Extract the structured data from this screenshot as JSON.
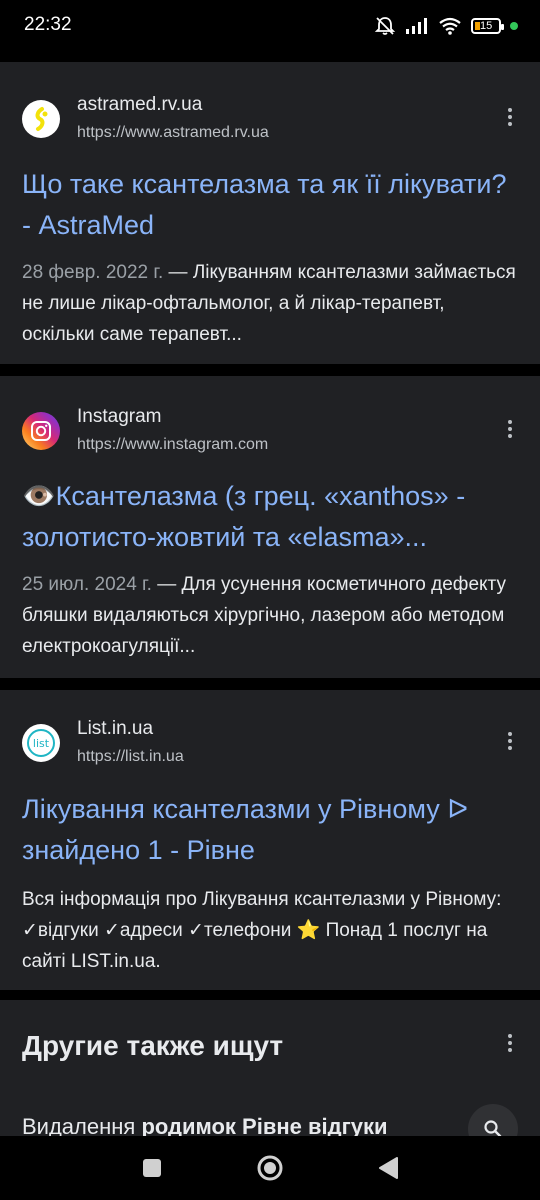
{
  "status_bar": {
    "time": "22:32",
    "battery": "15",
    "icons": [
      "mute-icon",
      "signal-icon",
      "wifi-icon",
      "battery-icon",
      "dot-icon"
    ]
  },
  "results": [
    {
      "site_name": "astramed.rv.ua",
      "url": "https://www.astramed.rv.ua",
      "title": "Що таке ксантелазма та як її лікувати? - AstraMed",
      "date": "28 февр. 2022 г.",
      "snippet": " — Лікуванням ксантелазми займається не лише лікар-офтальмолог, а й лікар-терапевт, оскільки саме терапевт..."
    },
    {
      "site_name": "Instagram",
      "url": "https://www.instagram.com",
      "title": "👁️Ксантелазма (з грец. «xanthos» - золотисто-жовтий та «elasma»...",
      "date": "25 июл. 2024 г.",
      "snippet": " — Для усунення косметичного дефекту бляшки видаляються хірургічно, лазером або методом електрокоагуляції..."
    },
    {
      "site_name": "List.in.ua",
      "url": "https://list.in.ua",
      "title": "Лікування ксантелазми у Рівному ᐅ знайдено 1 - Рівне",
      "date": "",
      "snippet": "Вся інформація про Лікування ксантелазми у Рівному: ✓відгуки ✓адреси ✓телефони ⭐ Понад 1 послуг на сайті LIST.in.ua."
    }
  ],
  "others": {
    "title": "Другие также ищут",
    "item_prefix": "Видалення ",
    "item_bold": "родимок Рівне відгуки"
  },
  "colors": {
    "link": "#8ab4f8",
    "card_bg": "#202124",
    "text": "#e8eaed",
    "muted": "#9aa0a6"
  }
}
